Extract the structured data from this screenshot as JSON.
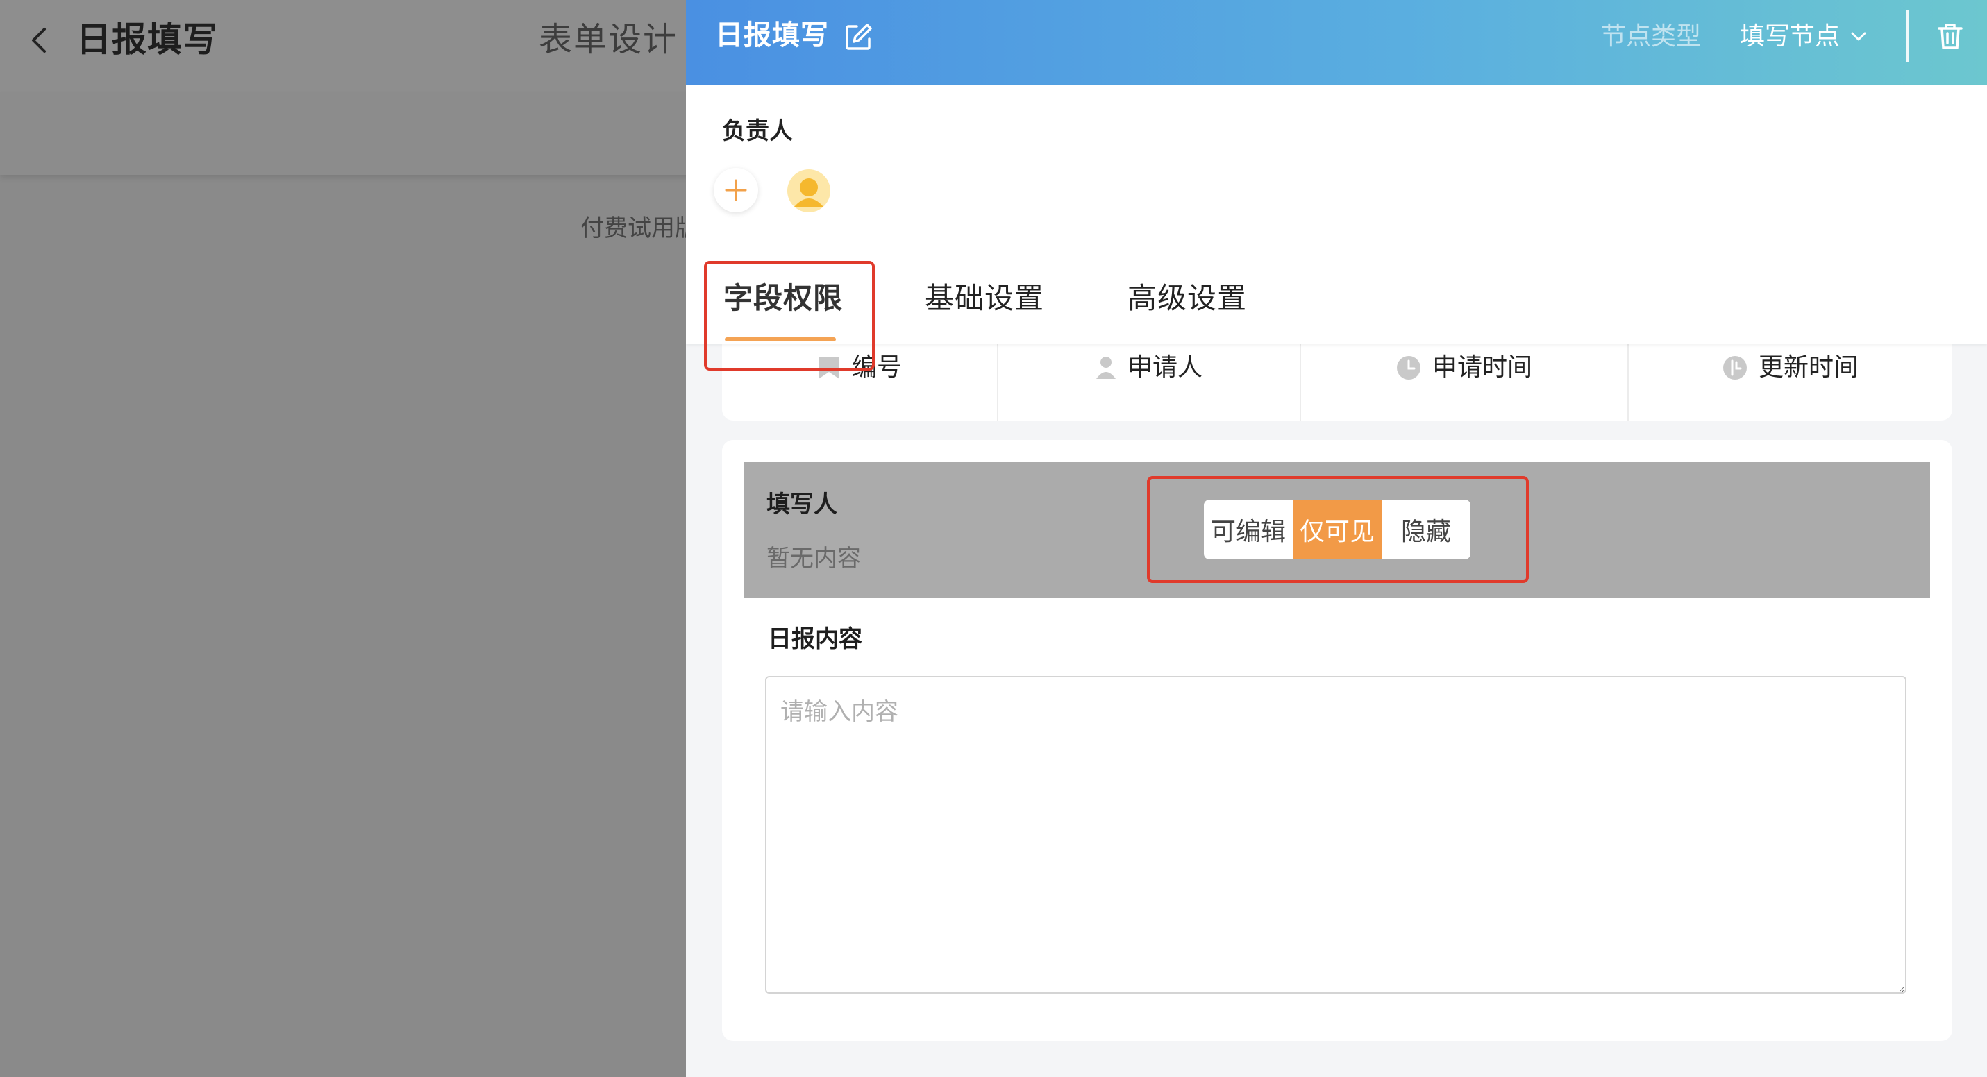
{
  "background": {
    "title": "日报填写",
    "tab_label": "表单设计",
    "trial_text": "付费试用版"
  },
  "drawer": {
    "title": "日报填写",
    "node_type_label": "节点类型",
    "node_type_value": "填写节点",
    "owner_label": "负责人",
    "tabs": [
      {
        "label": "字段权限",
        "active": true
      },
      {
        "label": "基础设置",
        "active": false
      },
      {
        "label": "高级设置",
        "active": false
      }
    ],
    "system_fields": [
      {
        "label": "编号",
        "icon": "bookmark-icon"
      },
      {
        "label": "申请人",
        "icon": "user-icon"
      },
      {
        "label": "申请时间",
        "icon": "clock-icon"
      },
      {
        "label": "更新时间",
        "icon": "refresh-clock-icon"
      }
    ],
    "fields": [
      {
        "label": "填写人",
        "value": "暂无内容",
        "permission_options": [
          "可编辑",
          "仅可见",
          "隐藏"
        ],
        "permission_selected": "仅可见"
      }
    ],
    "content_field": {
      "label": "日报内容",
      "placeholder": "请输入内容"
    }
  },
  "colors": {
    "accent": "#f29a47",
    "header_gradient_start": "#4a90e2",
    "header_gradient_end": "#6cc7cf",
    "annotation": "#e03a2b"
  }
}
